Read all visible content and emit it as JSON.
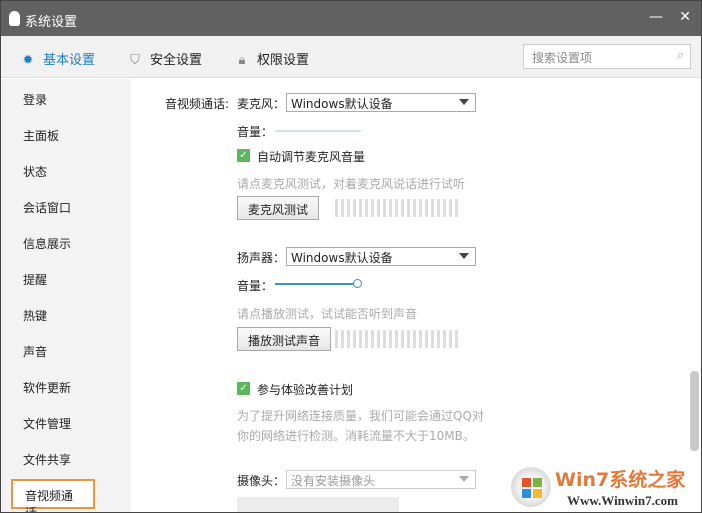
{
  "title": "系统设置",
  "tabs": [
    {
      "label": "基本设置",
      "icon": "gear-icon",
      "color": "#1c7fc1"
    },
    {
      "label": "安全设置",
      "icon": "shield-icon"
    },
    {
      "label": "权限设置",
      "icon": "lock-icon"
    }
  ],
  "search": {
    "placeholder": "搜索设置项"
  },
  "sidebar": {
    "items": [
      "登录",
      "主面板",
      "状态",
      "会话窗口",
      "信息展示",
      "提醒",
      "热键",
      "声音",
      "软件更新",
      "文件管理",
      "文件共享",
      "音视频通话"
    ],
    "selected": "音视频通话"
  },
  "main": {
    "section_label": "音视频通话:",
    "mic_label": "麦克风：",
    "mic_device": "Windows默认设备",
    "volume_label": "音量：",
    "auto_adjust": "自动调节麦克风音量",
    "mic_hint": "请点麦克风测试，对着麦克风说话进行试听",
    "mic_test_button": "麦克风测试",
    "speaker_label": "扬声器：",
    "speaker_device": "Windows默认设备",
    "speaker_volume_label": "音量：",
    "speaker_volume": 1.0,
    "speaker_hint": "请点播放测试，试试能否听到声音",
    "play_test_button": "播放测试声音",
    "experience_plan": "参与体验改善计划",
    "plan_desc_1": "为了提升网络连接质量，我们可能会通过QQ对",
    "plan_desc_2": "你的网络进行检测。消耗流量不大于10MB。",
    "camera_label": "摄像头：",
    "camera_device": "没有安装摄像头"
  },
  "watermark": {
    "brand": "Win7系统之家",
    "url": "Www.Winwin7.com"
  }
}
